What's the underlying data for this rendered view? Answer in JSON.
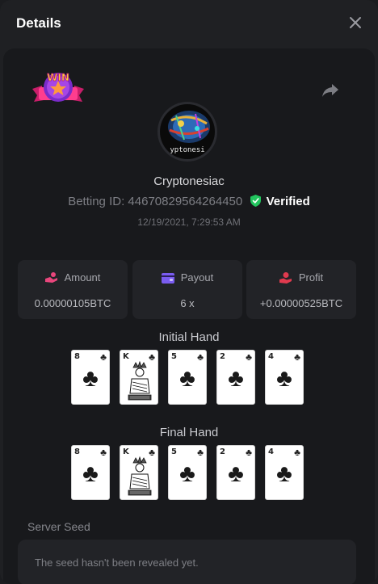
{
  "modal": {
    "title": "Details",
    "close_icon": "close-icon"
  },
  "bet": {
    "username": "Cryptonesiac",
    "avatar_caption": "yptonesi",
    "betting_id_label": "Betting ID:",
    "betting_id": "4467082956426445​0",
    "verified_label": "Verified",
    "timestamp": "12/19/2021, 7:29:53 AM",
    "badge_text": "WIN"
  },
  "stats": {
    "amount": {
      "label": "Amount",
      "value": "0.00000105BTC",
      "icon": "amount-hand-icon",
      "color": "#e8467c"
    },
    "payout": {
      "label": "Payout",
      "value": "6 x",
      "icon": "wallet-icon",
      "color": "#7a5cf0"
    },
    "profit": {
      "label": "Profit",
      "value": "+0.00000525BTC",
      "icon": "profit-hand-icon",
      "color": "#e03a4e"
    }
  },
  "hands": {
    "initial_title": "Initial Hand",
    "final_title": "Final Hand",
    "initial": [
      {
        "rank": "8",
        "suit": "♣"
      },
      {
        "rank": "K",
        "suit": "♣"
      },
      {
        "rank": "5",
        "suit": "♣"
      },
      {
        "rank": "2",
        "suit": "♣"
      },
      {
        "rank": "4",
        "suit": "♣"
      }
    ],
    "final": [
      {
        "rank": "8",
        "suit": "♣"
      },
      {
        "rank": "K",
        "suit": "♣"
      },
      {
        "rank": "5",
        "suit": "♣"
      },
      {
        "rank": "2",
        "suit": "♣"
      },
      {
        "rank": "4",
        "suit": "♣"
      }
    ]
  },
  "seed": {
    "label": "Server Seed",
    "text": "The seed hasn't been revealed yet."
  }
}
